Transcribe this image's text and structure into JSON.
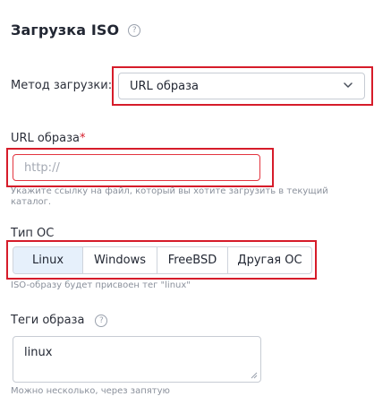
{
  "header": {
    "title": "Загрузка ISO",
    "help_icon": "question-circle-icon"
  },
  "method": {
    "label": "Метод загрузки:",
    "selected": "URL образа",
    "icon": "chevron-down-icon"
  },
  "url": {
    "label": "URL образа",
    "required_mark": "*",
    "placeholder": "http://",
    "value": "",
    "hint": "Укажите ссылку на файл, который вы хотите загрузить в текущий каталог."
  },
  "os_type": {
    "label": "Тип ОС",
    "options": [
      "Linux",
      "Windows",
      "FreeBSD",
      "Другая ОС"
    ],
    "selected": "Linux",
    "hint": "ISO-образу будет присвоен тег \"linux\""
  },
  "tags": {
    "label": "Теги образа",
    "help_icon": "question-circle-icon",
    "value": "linux",
    "hint": "Можно несколько, через запятую"
  },
  "colors": {
    "highlight": "#d61c2a",
    "active_segment": "#e6f0fb",
    "error_border": "#e3343f"
  }
}
